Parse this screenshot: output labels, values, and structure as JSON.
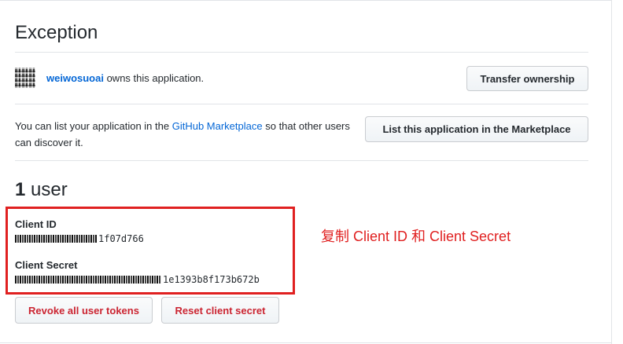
{
  "section": {
    "title": "Exception"
  },
  "owner": {
    "name": "weiwosuoai",
    "suffix": " owns this application.",
    "transfer_button": "Transfer ownership"
  },
  "marketplace": {
    "text_before": "You can list your application in the ",
    "link": "GitHub Marketplace",
    "text_after": " so that other users can discover it.",
    "button": "List this application in the Marketplace"
  },
  "users": {
    "count": "1",
    "label": " user"
  },
  "credentials": {
    "client_id_label": "Client ID",
    "client_id_visible": "1f07d766",
    "client_secret_label": "Client Secret",
    "client_secret_visible": "1e1393b8f173b672b"
  },
  "actions": {
    "revoke": "Revoke all user tokens",
    "reset": "Reset client secret"
  },
  "annotation": {
    "text": "复制 Client ID 和 Client Secret"
  },
  "colors": {
    "link": "#0366d6",
    "danger": "#cb2431",
    "highlight": "#e02020"
  }
}
